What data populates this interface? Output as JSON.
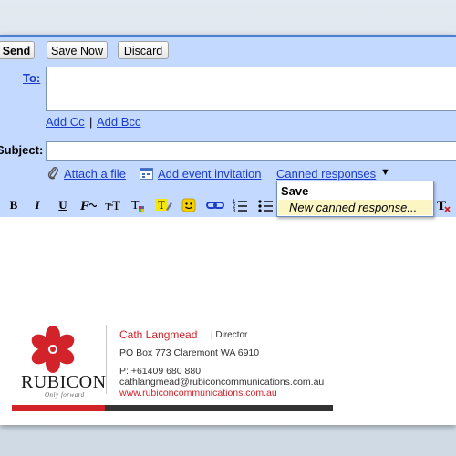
{
  "toolbar_top": {
    "send_label": "Send",
    "save_now_label": "Save Now",
    "discard_label": "Discard"
  },
  "fields": {
    "to_label": "To:",
    "to_value": "",
    "add_cc": "Add Cc",
    "separator": "|",
    "add_bcc": "Add Bcc",
    "subject_label": "Subject:",
    "subject_value": ""
  },
  "actions": {
    "attach_file": "Attach a file",
    "add_event": "Add event invitation",
    "canned_responses": "Canned responses",
    "canned_arrow": "▼"
  },
  "dropdown": {
    "save": "Save",
    "new_canned": "New canned response..."
  },
  "format_toolbar": {
    "bold": "B",
    "italic": "I",
    "underline": "U"
  },
  "signature": {
    "name": "Cath Langmead",
    "title": "| Director",
    "address": "PO Box 773 Claremont WA 6910",
    "phone": "P: +61409 680 880",
    "email": "cathlangmead@rubiconcommunications.com.au",
    "website": "www.rubiconcommunications.com.au",
    "logo_name": "RUBICON",
    "logo_tagline": "Only forward"
  },
  "colors": {
    "panel_bg": "#c3d9ff",
    "accent_blue": "#4c7fd1",
    "link_blue": "#1a3ccb",
    "brand_red": "#d2232a"
  }
}
